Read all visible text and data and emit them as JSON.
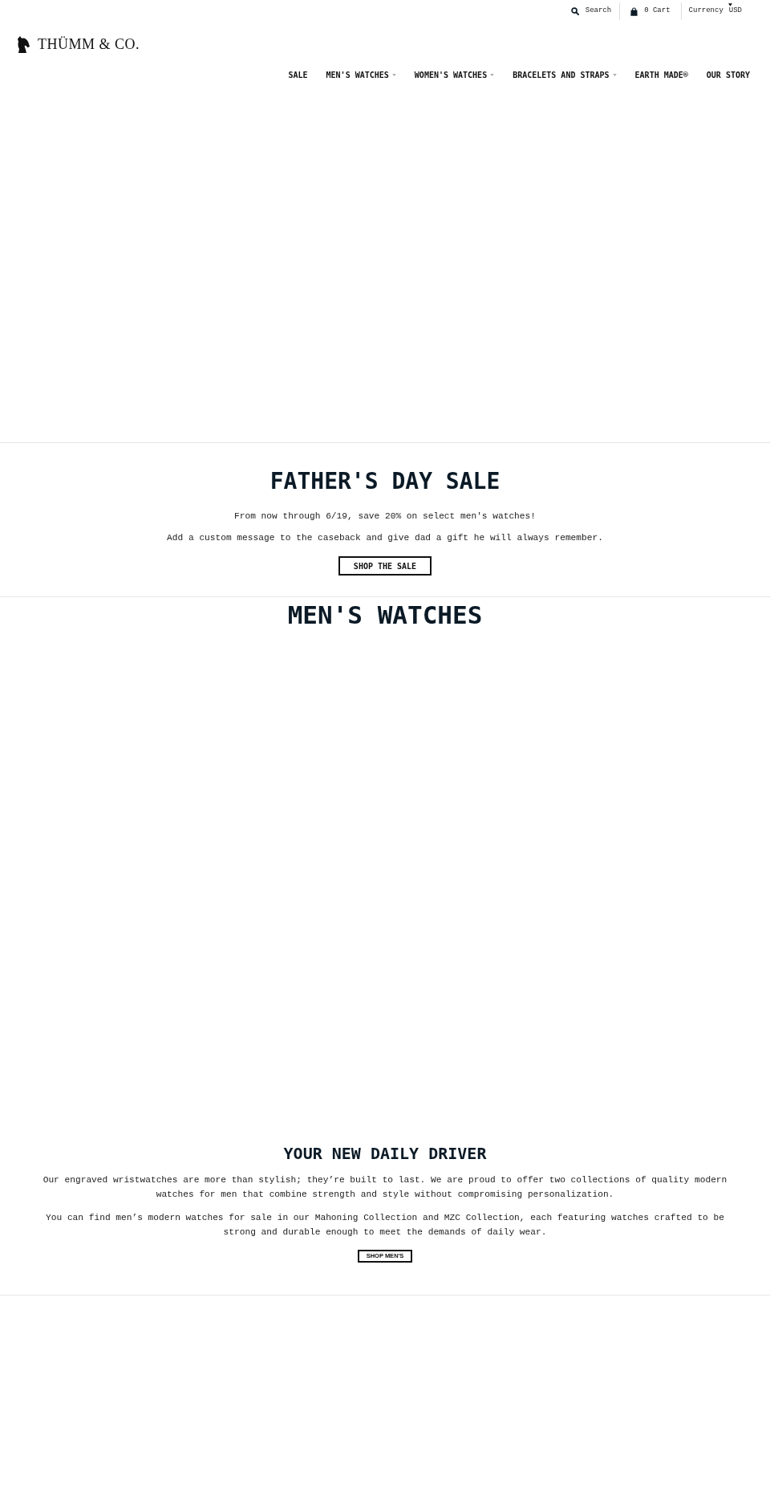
{
  "top_bar": {
    "search": "Search",
    "cart": "0 Cart",
    "currency_label": "Currency",
    "currency_value": "USD"
  },
  "logo": {
    "text": "THÜMM & CO."
  },
  "nav": [
    {
      "label": "SALE",
      "dropdown": false
    },
    {
      "label": "MEN'S WATCHES",
      "dropdown": true
    },
    {
      "label": "WOMEN'S WATCHES",
      "dropdown": true
    },
    {
      "label": "BRACELETS AND STRAPS",
      "dropdown": true
    },
    {
      "label": "EARTH MADE®",
      "dropdown": false
    },
    {
      "label": "OUR STORY",
      "dropdown": false
    }
  ],
  "promo": {
    "title": "FATHER'S DAY SALE",
    "paragraphs": [
      "From now through 6/19, save 20% on select men's watches!",
      "Add a custom message to the caseback and give dad a gift he will always remember."
    ],
    "button": "SHOP THE SALE"
  },
  "mens_watches": {
    "title": "MEN'S WATCHES",
    "subtitle": "YOUR NEW DAILY DRIVER",
    "paragraphs": [
      "Our engraved wristwatches are more than stylish; they’re built to last. We are proud to offer two collections of quality modern watches for men that combine strength and style without compromising personalization.",
      "You can find men’s modern watches for sale in our Mahoning Collection and MZC Collection, each featuring watches crafted to be strong and durable enough to meet the demands of daily wear."
    ],
    "button": "SHOP MEN'S"
  }
}
